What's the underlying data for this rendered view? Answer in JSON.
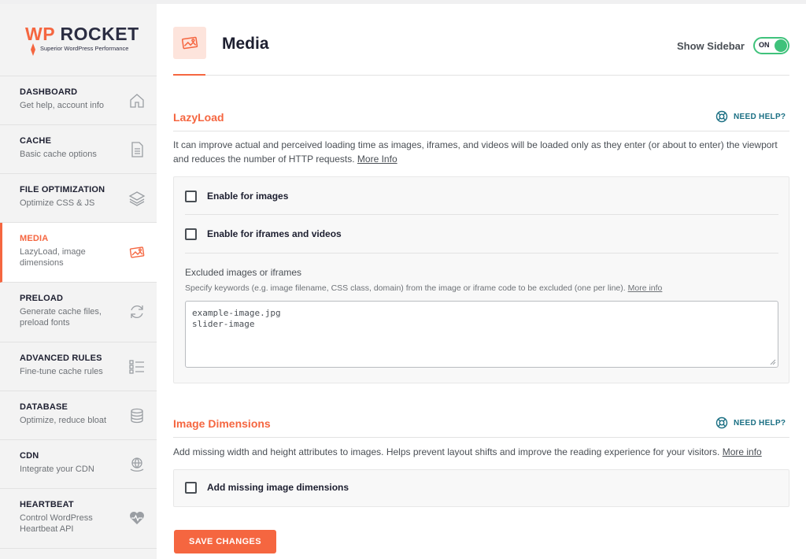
{
  "brand": {
    "name_wp": "WP",
    "name_rocket": "ROCKET",
    "tagline": "Superior WordPress Performance",
    "accent": "#f56640"
  },
  "sidebar": {
    "items": [
      {
        "title": "DASHBOARD",
        "subtitle": "Get help, account info",
        "icon": "home-icon"
      },
      {
        "title": "CACHE",
        "subtitle": "Basic cache options",
        "icon": "file-icon"
      },
      {
        "title": "FILE OPTIMIZATION",
        "subtitle": "Optimize CSS & JS",
        "icon": "layers-icon"
      },
      {
        "title": "MEDIA",
        "subtitle": "LazyLoad, image dimensions",
        "icon": "images-icon",
        "active": true
      },
      {
        "title": "PRELOAD",
        "subtitle": "Generate cache files, preload fonts",
        "icon": "refresh-icon"
      },
      {
        "title": "ADVANCED RULES",
        "subtitle": "Fine-tune cache rules",
        "icon": "list-icon"
      },
      {
        "title": "DATABASE",
        "subtitle": "Optimize, reduce bloat",
        "icon": "database-icon"
      },
      {
        "title": "CDN",
        "subtitle": "Integrate your CDN",
        "icon": "globe-hand-icon"
      },
      {
        "title": "HEARTBEAT",
        "subtitle": "Control WordPress Heartbeat API",
        "icon": "heartbeat-icon"
      }
    ]
  },
  "header": {
    "title": "Media",
    "show_sidebar_label": "Show Sidebar",
    "toggle_state": "ON"
  },
  "lazyload": {
    "title": "LazyLoad",
    "need_help": "NEED HELP?",
    "description": "It can improve actual and perceived loading time as images, iframes, and videos will be loaded only as they enter (or about to enter) the viewport and reduces the number of HTTP requests.",
    "more_info": "More Info",
    "enable_images": "Enable for images",
    "enable_iframes": "Enable for iframes and videos",
    "excluded_label": "Excluded images or iframes",
    "excluded_help": "Specify keywords (e.g. image filename, CSS class, domain) from the image or iframe code to be excluded (one per line).",
    "excluded_more": "More info",
    "excluded_value": "example-image.jpg\nslider-image"
  },
  "dimensions": {
    "title": "Image Dimensions",
    "need_help": "NEED HELP?",
    "description": "Add missing width and height attributes to images. Helps prevent layout shifts and improve the reading experience for your visitors.",
    "more_info": "More info",
    "add_missing": "Add missing image dimensions"
  },
  "save_label": "SAVE CHANGES",
  "colors": {
    "toggle_on": "#3fc27b",
    "help_link": "#1a6f83"
  }
}
